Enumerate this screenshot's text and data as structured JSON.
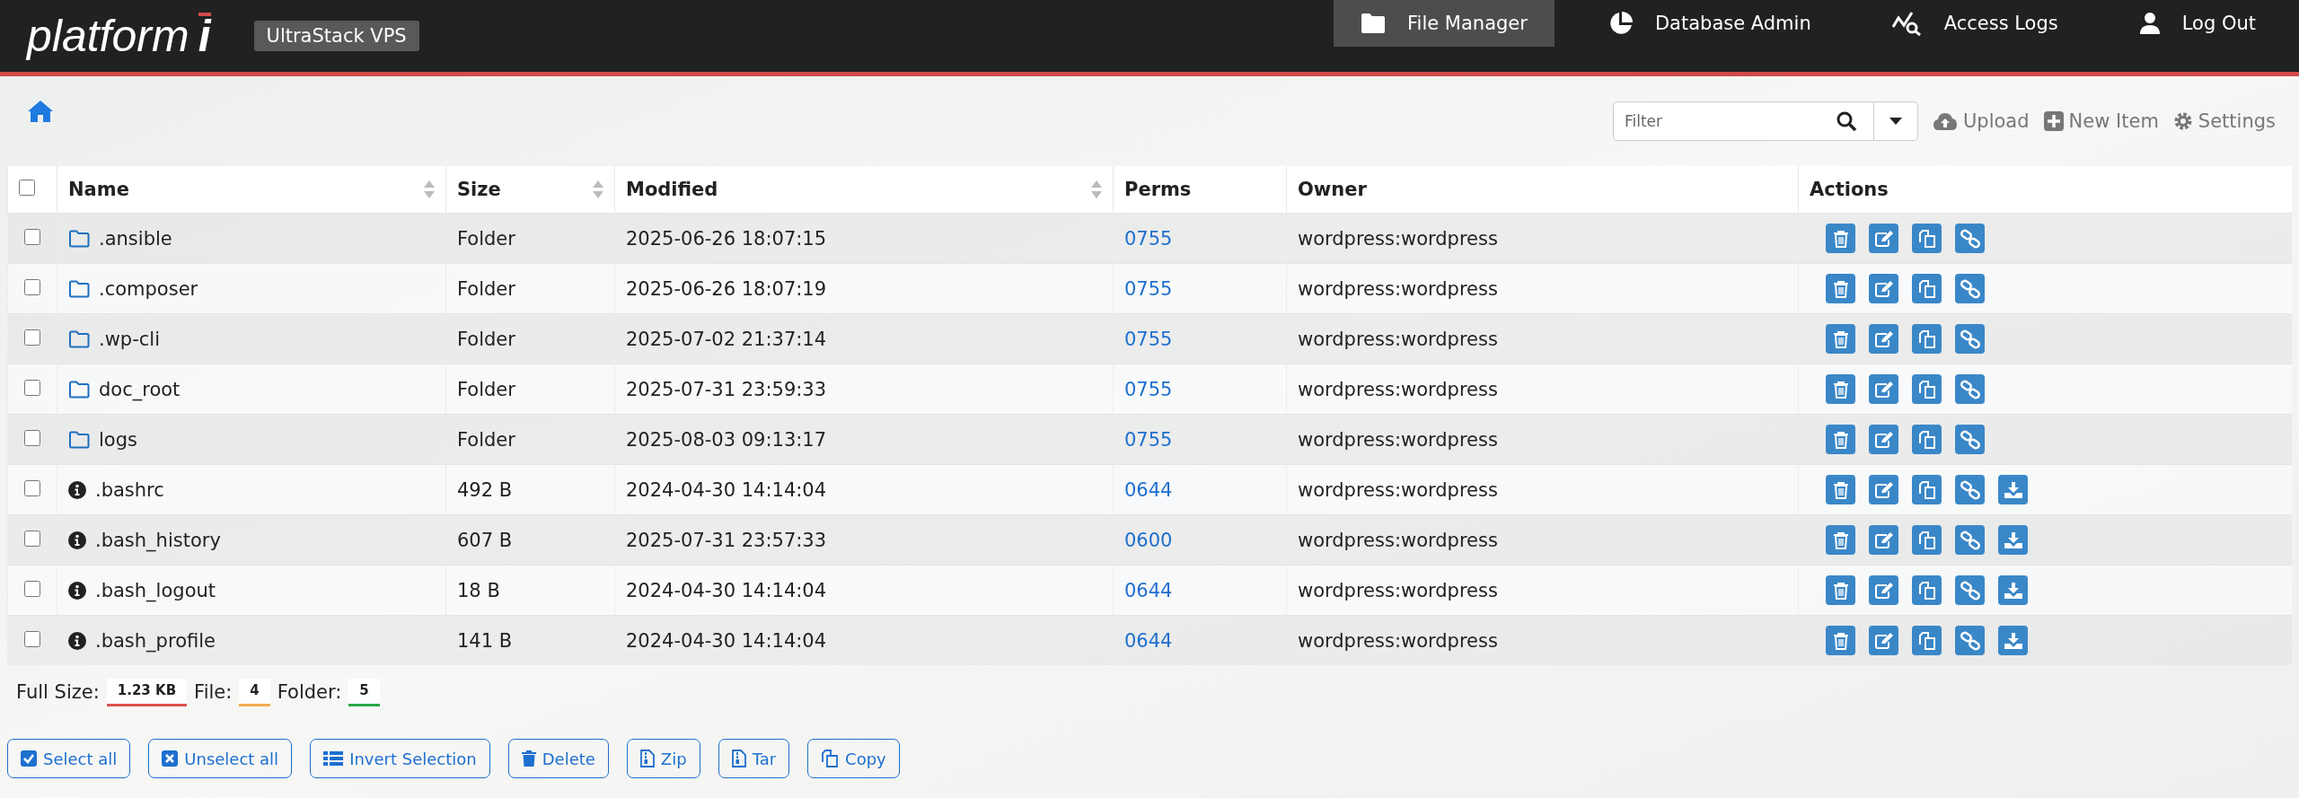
{
  "header": {
    "logo": {
      "text": "platform",
      "mark": "i"
    },
    "badge": "UltraStack VPS",
    "nav": [
      {
        "label": "File Manager",
        "kind": "folder",
        "selected": true
      },
      {
        "label": "Database Admin",
        "kind": "pie",
        "selected": false
      },
      {
        "label": "Access Logs",
        "kind": "logs",
        "selected": false
      },
      {
        "label": "Log Out",
        "kind": "user",
        "selected": false
      }
    ]
  },
  "toolbar": {
    "filter": {
      "placeholder": "Filter"
    },
    "actions": [
      {
        "label": "Upload",
        "kind": "upload"
      },
      {
        "label": "New Item",
        "kind": "new"
      },
      {
        "label": "Settings",
        "kind": "settings"
      }
    ]
  },
  "table": {
    "select_all": {
      "checked": false
    },
    "columns": [
      {
        "label": "Name",
        "sortable": true
      },
      {
        "label": "Size",
        "sortable": true
      },
      {
        "label": "Modified",
        "sortable": true
      },
      {
        "label": "Perms",
        "sortable": false
      },
      {
        "label": "Owner",
        "sortable": false
      },
      {
        "label": "Actions",
        "sortable": false
      }
    ],
    "rows": [
      {
        "kind": "folder",
        "checked": false,
        "name": ".ansible",
        "size": "Folder",
        "modified": "2025-06-26 18:07:15",
        "perms": "0755",
        "owner": "wordpress:wordpress"
      },
      {
        "kind": "folder",
        "checked": false,
        "name": ".composer",
        "size": "Folder",
        "modified": "2025-06-26 18:07:19",
        "perms": "0755",
        "owner": "wordpress:wordpress"
      },
      {
        "kind": "folder",
        "checked": false,
        "name": ".wp-cli",
        "size": "Folder",
        "modified": "2025-07-02 21:37:14",
        "perms": "0755",
        "owner": "wordpress:wordpress"
      },
      {
        "kind": "folder",
        "checked": false,
        "name": "doc_root",
        "size": "Folder",
        "modified": "2025-07-31 23:59:33",
        "perms": "0755",
        "owner": "wordpress:wordpress"
      },
      {
        "kind": "folder",
        "checked": false,
        "name": "logs",
        "size": "Folder",
        "modified": "2025-08-03 09:13:17",
        "perms": "0755",
        "owner": "wordpress:wordpress"
      },
      {
        "kind": "file",
        "checked": false,
        "name": ".bashrc",
        "size": "492 B",
        "modified": "2024-04-30 14:14:04",
        "perms": "0644",
        "owner": "wordpress:wordpress"
      },
      {
        "kind": "file",
        "checked": false,
        "name": ".bash_history",
        "size": "607 B",
        "modified": "2025-07-31 23:57:33",
        "perms": "0600",
        "owner": "wordpress:wordpress"
      },
      {
        "kind": "file",
        "checked": false,
        "name": ".bash_logout",
        "size": "18 B",
        "modified": "2024-04-30 14:14:04",
        "perms": "0644",
        "owner": "wordpress:wordpress"
      },
      {
        "kind": "file",
        "checked": false,
        "name": ".bash_profile",
        "size": "141 B",
        "modified": "2024-04-30 14:14:04",
        "perms": "0644",
        "owner": "wordpress:wordpress"
      }
    ]
  },
  "summary": [
    {
      "label": "Full Size:",
      "value": "1.23 KB",
      "color": "#d9534f"
    },
    {
      "label": "File:",
      "value": "4",
      "color": "#f0ad4e"
    },
    {
      "label": "Folder:",
      "value": "5",
      "color": "#28a745"
    }
  ],
  "buttons": [
    {
      "label": "Select all",
      "kind": "check"
    },
    {
      "label": "Unselect all",
      "kind": "cross"
    },
    {
      "label": "Invert Selection",
      "kind": "list"
    },
    {
      "label": "Delete",
      "kind": "trash"
    },
    {
      "label": "Zip",
      "kind": "archive"
    },
    {
      "label": "Tar",
      "kind": "archive"
    },
    {
      "label": "Copy",
      "kind": "copy"
    }
  ]
}
